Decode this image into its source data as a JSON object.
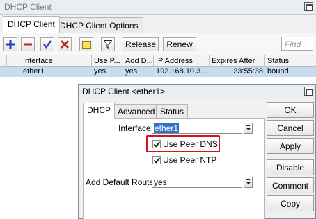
{
  "window": {
    "title": "DHCP Client"
  },
  "tabs": [
    "DHCP Client",
    "DHCP Client Options"
  ],
  "toolbar": {
    "icons": [
      "plus-icon",
      "minus-icon",
      "check-icon",
      "cross-icon",
      "note-icon",
      "filter-icon"
    ],
    "release_label": "Release",
    "renew_label": "Renew",
    "find_placeholder": "Find"
  },
  "table": {
    "columns": [
      "Interface",
      "Use P...",
      "Add D...",
      "IP Address",
      "Expires After",
      "Status"
    ],
    "rows": [
      {
        "interface": "ether1",
        "use_peer": "yes",
        "add_default": "yes",
        "ip_address": "192.168.10.3...",
        "expires_after": "23:55:38",
        "status": "bound"
      }
    ]
  },
  "dialog": {
    "title": "DHCP Client <ether1>",
    "tabs": [
      "DHCP",
      "Advanced",
      "Status"
    ],
    "interface_label": "Interface:",
    "interface_value": "ether1",
    "use_peer_dns_label": "Use Peer DNS",
    "use_peer_dns_checked": true,
    "use_peer_ntp_label": "Use Peer NTP",
    "use_peer_ntp_checked": true,
    "default_route_label": "Add Default Route:",
    "default_route_value": "yes",
    "buttons": [
      "OK",
      "Cancel",
      "Apply",
      "Disable",
      "Comment",
      "Copy"
    ]
  },
  "colors": {
    "selected_row": "#c8dcf1",
    "highlight_box": "#d3131f",
    "add_icon": "#1f3fbf",
    "remove_icon": "#c0232a"
  }
}
